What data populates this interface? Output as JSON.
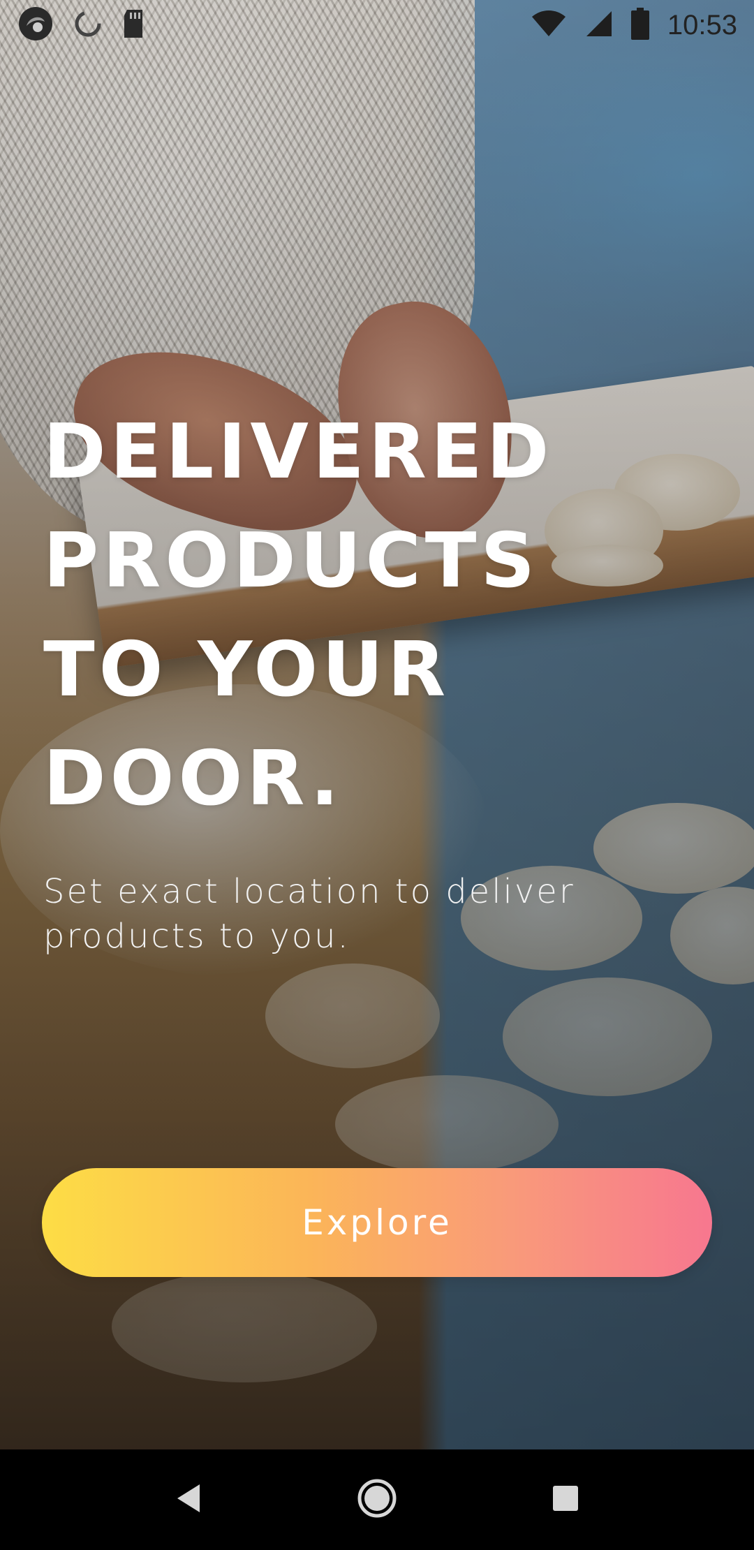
{
  "status_bar": {
    "time": "10:53",
    "icons_left": [
      "app-notification-icon",
      "sync-icon",
      "sd-card-icon"
    ],
    "icons_right": [
      "wifi-icon",
      "cellular-signal-icon",
      "battery-icon"
    ]
  },
  "hero": {
    "title_lines": [
      "DELIVERED",
      "PRODUCTS",
      "TO YOUR",
      "DOOR."
    ],
    "subtitle": "Set exact location to deliver products to you."
  },
  "actions": {
    "explore_label": "Explore"
  },
  "nav_bar": {
    "buttons": [
      "back-icon",
      "home-icon",
      "recents-icon"
    ]
  },
  "colors": {
    "button_gradient_start": "#fddd45",
    "button_gradient_end": "#f7778f",
    "title_text": "#ffffff",
    "nav_background": "#000000"
  }
}
